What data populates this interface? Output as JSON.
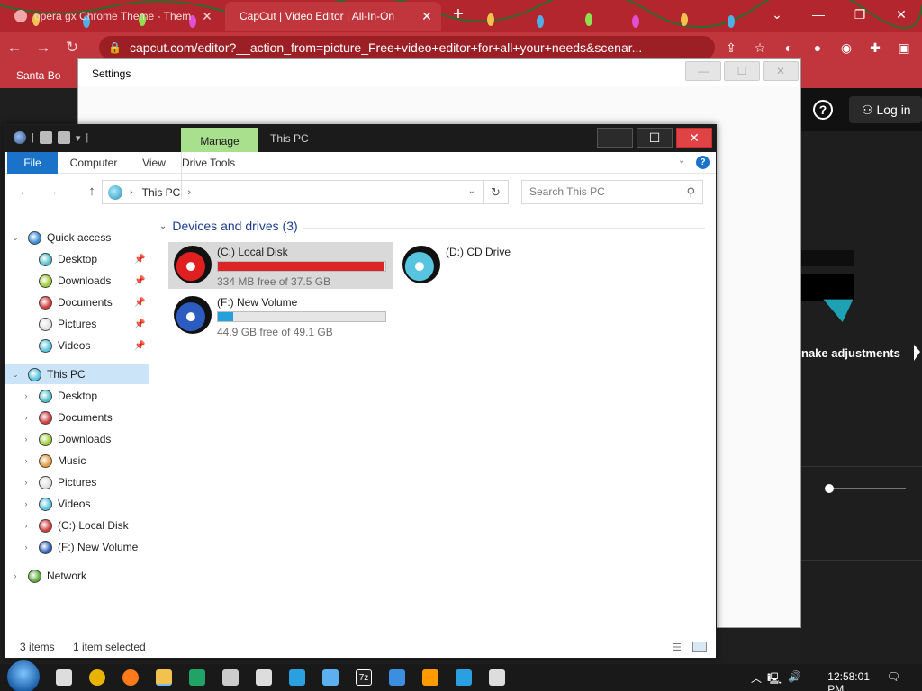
{
  "chrome": {
    "tabs": [
      {
        "title": "opera gx Chrome Theme - Them",
        "close": "✕"
      },
      {
        "title": "CapCut | Video Editor | All-In-On",
        "close": "✕"
      }
    ],
    "new_tab": "+",
    "window_controls": {
      "minimize": "—",
      "maximize": "❐",
      "close": "✕"
    },
    "url": "capcut.com/editor?__action_from=picture_Free+video+editor+for+all+your+needs&scenar...",
    "bookmark": "Santa Bo",
    "colors": {
      "frame": "#b3262d",
      "toolbar": "#c1353c"
    }
  },
  "capcut": {
    "help": "?",
    "login_label": "Log in",
    "adjust_text": "nake adjustments",
    "slider_value": 0.05
  },
  "settings": {
    "title": "Settings",
    "controls": {
      "minimize": "—",
      "maximize": "☐",
      "close": "✕"
    }
  },
  "explorer": {
    "context_tab": "Manage",
    "title": "This PC",
    "controls": {
      "minimize": "—",
      "maximize": "☐",
      "close": "✕"
    },
    "ribbon_tabs": [
      "File",
      "Computer",
      "View",
      "Drive Tools"
    ],
    "address": {
      "location": "This PC"
    },
    "search_placeholder": "Search This PC",
    "nav": [
      {
        "label": "Quick access",
        "icon": "star-icon",
        "exp": "v",
        "indent": 0,
        "color": "#3a8ed8"
      },
      {
        "label": "Desktop",
        "icon": "desktop-ornament-icon",
        "pin": true,
        "indent": 1,
        "color": "#4fc1c9"
      },
      {
        "label": "Downloads",
        "icon": "downloads-ornament-icon",
        "pin": true,
        "indent": 1,
        "color": "#9ccc32"
      },
      {
        "label": "Documents",
        "icon": "documents-ornament-icon",
        "pin": true,
        "indent": 1,
        "color": "#d43a3a"
      },
      {
        "label": "Pictures",
        "icon": "pictures-ornament-icon",
        "pin": true,
        "indent": 1,
        "color": "#e0e0e0"
      },
      {
        "label": "Videos",
        "icon": "videos-ornament-icon",
        "pin": true,
        "indent": 1,
        "color": "#58c5e0"
      },
      {
        "label": "This PC",
        "icon": "this-pc-icon",
        "exp": "v",
        "indent": 0,
        "selected": true,
        "color": "#58c5e0"
      },
      {
        "label": "Desktop",
        "icon": "desktop-ornament-icon",
        "exp": ">",
        "indent": 1,
        "color": "#4fc1c9"
      },
      {
        "label": "Documents",
        "icon": "documents-ornament-icon",
        "exp": ">",
        "indent": 1,
        "color": "#d43a3a"
      },
      {
        "label": "Downloads",
        "icon": "downloads-ornament-icon",
        "exp": ">",
        "indent": 1,
        "color": "#9ccc32"
      },
      {
        "label": "Music",
        "icon": "music-ornament-icon",
        "exp": ">",
        "indent": 1,
        "color": "#e89a3c"
      },
      {
        "label": "Pictures",
        "icon": "pictures-ornament-icon",
        "exp": ">",
        "indent": 1,
        "color": "#e0e0e0"
      },
      {
        "label": "Videos",
        "icon": "videos-ornament-icon",
        "exp": ">",
        "indent": 1,
        "color": "#58c5e0"
      },
      {
        "label": "(C:) Local Disk",
        "icon": "local-disk-icon",
        "exp": ">",
        "indent": 1,
        "color": "#d43a3a"
      },
      {
        "label": "(F:) New Volume",
        "icon": "new-volume-icon",
        "exp": ">",
        "indent": 1,
        "color": "#2c5cc0"
      },
      {
        "label": "Network",
        "icon": "network-icon",
        "exp": ">",
        "indent": 0,
        "color": "#5fae3c"
      }
    ],
    "group_header": "Devices and drives (3)",
    "drives": [
      {
        "name": "(C:) Local Disk",
        "free": "334 MB free of 37.5 GB",
        "used_fraction": 0.99,
        "bar_color": "#da2626",
        "icon_color": "#e02020",
        "selected": true,
        "has_bar": true
      },
      {
        "name": "(D:) CD Drive",
        "free": "",
        "icon_color": "#58c5e0",
        "has_bar": false
      },
      {
        "name": "(F:) New Volume",
        "free": "44.9 GB free of 49.1 GB",
        "used_fraction": 0.09,
        "bar_color": "#26a0da",
        "icon_color": "#2c5cc0",
        "has_bar": true
      }
    ],
    "status": {
      "items": "3 items",
      "selected": "1 item selected"
    }
  },
  "taskbar": {
    "apps": [
      "task-view-icon",
      "chrome-icon",
      "firefox-icon",
      "file-explorer-icon",
      "excel-icon",
      "printer-icon",
      "app-window-icon",
      "photo-app-icon",
      "settings-app-icon",
      "7zip-icon",
      "media-icon",
      "search-app-icon",
      "capture-icon",
      "gear-icon"
    ],
    "zip_label": "7z",
    "time": "12:58:01 PM"
  }
}
